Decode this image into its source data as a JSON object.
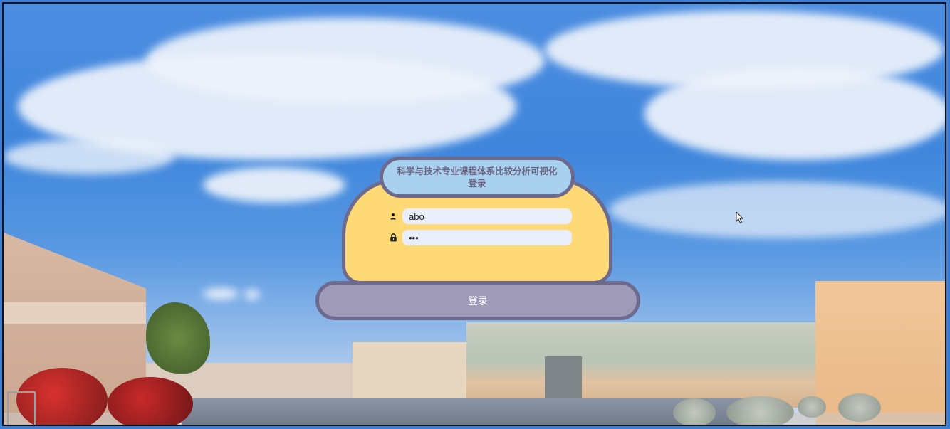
{
  "login": {
    "title": "科学与技术专业课程体系比较分析可视化登录",
    "username": {
      "icon": "user-icon",
      "value": "abo"
    },
    "password": {
      "icon": "lock-icon",
      "value": "•••"
    },
    "submit_label": "登录"
  },
  "colors": {
    "panel": "#ffd975",
    "title_bg": "#a8d1f0",
    "border": "#6e6a8e",
    "button_bg": "#9e9ab8",
    "input_bg": "#e8eefa"
  }
}
